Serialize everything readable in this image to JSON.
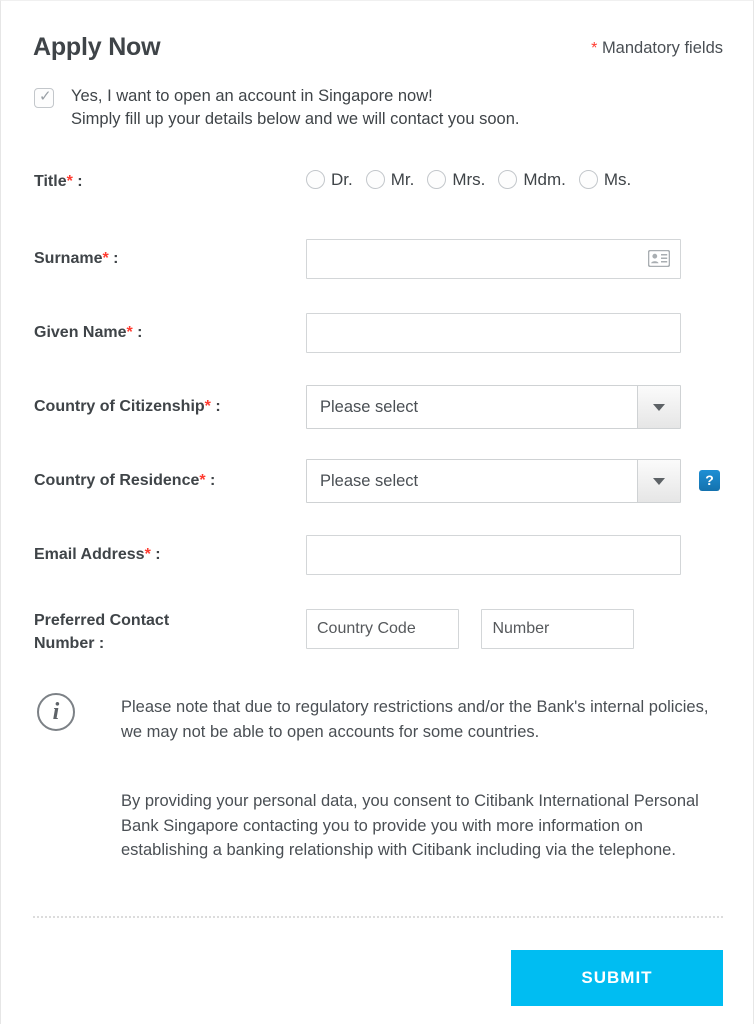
{
  "header": {
    "title": "Apply Now",
    "mandatory_marker": "*",
    "mandatory_text": "Mandatory fields"
  },
  "consent": {
    "checked": true,
    "line1": "Yes, I want to open an account in Singapore now!",
    "line2": "Simply fill up your details below and we will contact you soon."
  },
  "fields": {
    "title": {
      "label": "Title",
      "required_marker": "*",
      "colon": ":",
      "options": [
        {
          "label": "Dr.",
          "selected": false
        },
        {
          "label": "Mr.",
          "selected": false
        },
        {
          "label": "Mrs.",
          "selected": false
        },
        {
          "label": "Mdm.",
          "selected": false
        },
        {
          "label": "Ms.",
          "selected": false
        }
      ]
    },
    "surname": {
      "label": "Surname",
      "required_marker": "*",
      "colon": ":",
      "value": "",
      "placeholder": "",
      "icon": "contact-card-icon"
    },
    "given_name": {
      "label": "Given Name",
      "required_marker": "*",
      "colon": ":",
      "value": "",
      "placeholder": ""
    },
    "country_of_citizenship": {
      "label": "Country of Citizenship",
      "required_marker": "*",
      "colon": ":",
      "selected": "Please select"
    },
    "country_of_residence": {
      "label": "Country of Residence",
      "required_marker": "*",
      "colon": ":",
      "selected": "Please select",
      "help_label": "?"
    },
    "email_address": {
      "label": "Email Address",
      "required_marker": "*",
      "colon": ":",
      "value": "",
      "placeholder": ""
    },
    "preferred_contact_number": {
      "label_line1": "Preferred Contact",
      "label_line2": "Number :",
      "country_code_placeholder": "Country Code",
      "country_code_value": "",
      "number_placeholder": "Number",
      "number_value": ""
    }
  },
  "notes": {
    "icon": "info-icon",
    "paragraph1": "Please note that due to regulatory restrictions and/or the Bank's internal policies, we may not be able to open accounts for some countries.",
    "paragraph2": "By providing your personal data, you consent to Citibank International Personal Bank Singapore contacting you to provide you with more information on establishing a banking relationship with Citibank including via the telephone."
  },
  "footer": {
    "submit_label": "SUBMIT"
  },
  "colors": {
    "accent": "#00bdf2",
    "required_star": "#ff3b30",
    "text": "#3f4448",
    "help_blue": "#1472ae"
  }
}
